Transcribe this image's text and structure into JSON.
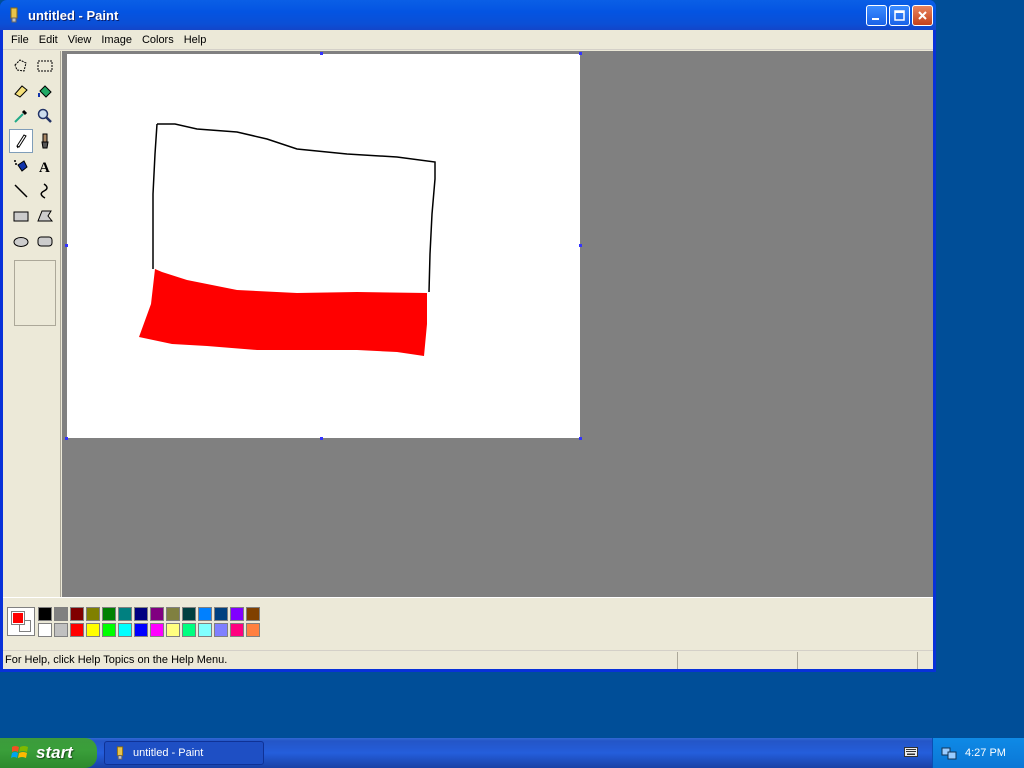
{
  "window": {
    "title": "untitled - Paint"
  },
  "menu": {
    "items": [
      "File",
      "Edit",
      "View",
      "Image",
      "Colors",
      "Help"
    ]
  },
  "tools": [
    "free-form-select",
    "select",
    "eraser",
    "fill",
    "pick-color",
    "magnifier",
    "pencil",
    "brush",
    "airbrush",
    "text",
    "line",
    "curve",
    "rectangle",
    "polygon",
    "ellipse",
    "rounded-rectangle"
  ],
  "selected_tool": "pencil",
  "palette": {
    "foreground": "#ff0000",
    "background": "#ffffff",
    "row1": [
      "#000000",
      "#808080",
      "#800000",
      "#808000",
      "#008000",
      "#008080",
      "#000080",
      "#800080",
      "#808040",
      "#004040",
      "#0080ff",
      "#004080",
      "#8000ff",
      "#804000"
    ],
    "row2": [
      "#ffffff",
      "#c0c0c0",
      "#ff0000",
      "#ffff00",
      "#00ff00",
      "#00ffff",
      "#0000ff",
      "#ff00ff",
      "#ffff80",
      "#00ff80",
      "#80ffff",
      "#8080ff",
      "#ff0080",
      "#ff8040"
    ]
  },
  "status": {
    "text": "For Help, click Help Topics on the Help Menu."
  },
  "taskbar": {
    "start_label": "start",
    "task_label": "untitled - Paint",
    "clock": "4:27 PM"
  }
}
